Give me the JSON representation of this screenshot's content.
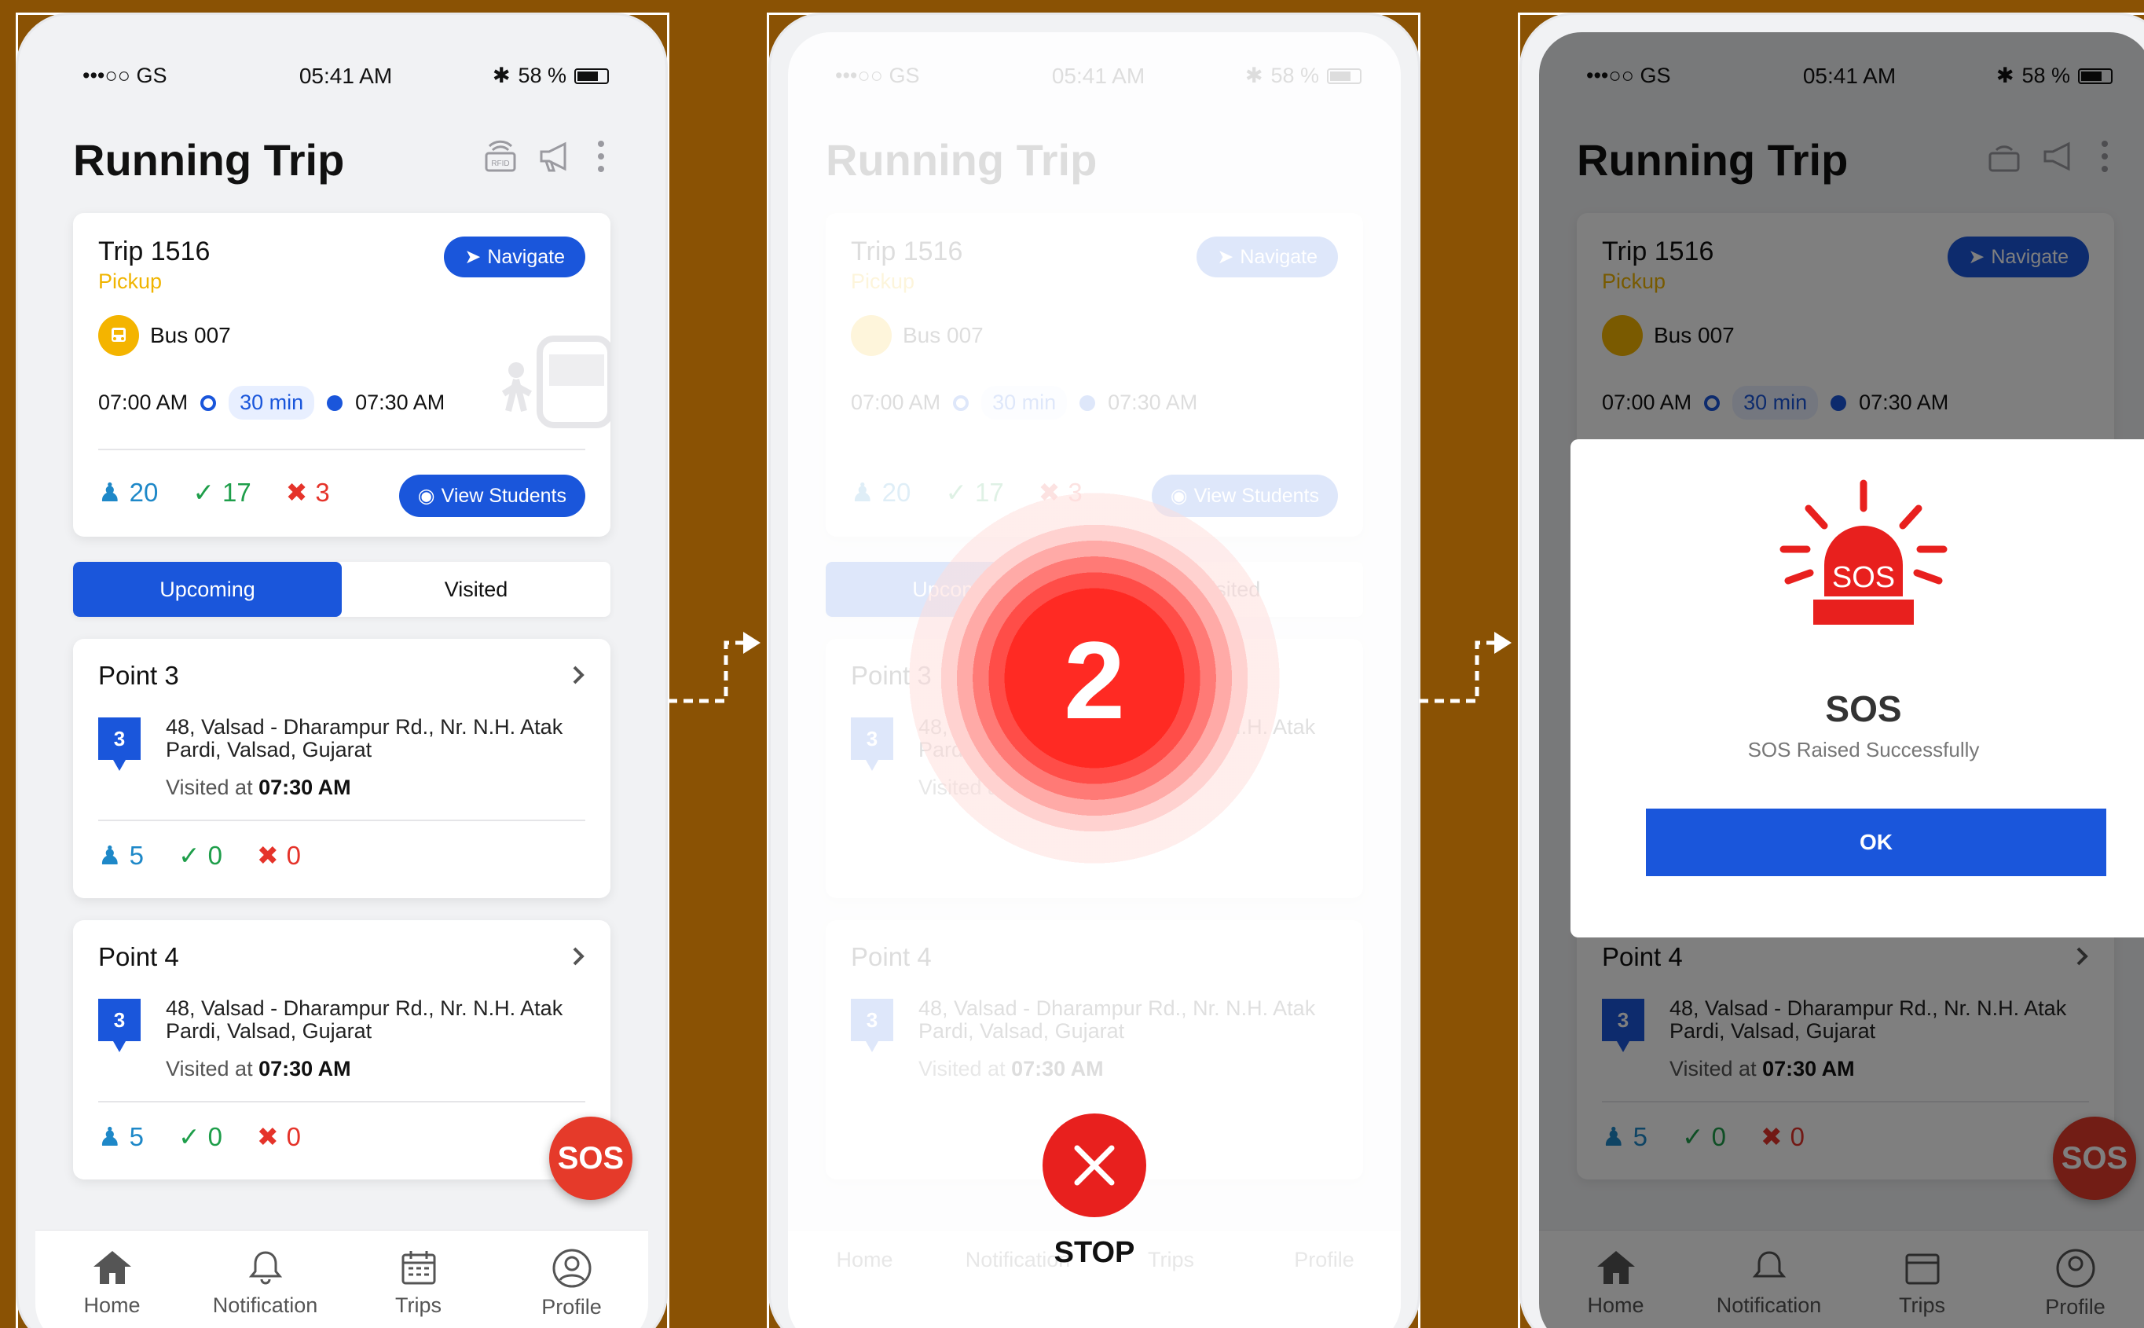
{
  "status": {
    "carrier": "•••○○ GS",
    "time": "05:41 AM",
    "battery": "58 %"
  },
  "header": {
    "title": "Running Trip"
  },
  "trip": {
    "name": "Trip 1516",
    "type": "Pickup",
    "navigate_label": "Navigate",
    "bus": "Bus 007",
    "start_time": "07:00 AM",
    "duration": "30 min",
    "end_time": "07:30 AM",
    "total": "20",
    "present": "17",
    "absent": "3",
    "view_students_label": "View Students"
  },
  "tabs": {
    "upcoming": "Upcoming",
    "visited": "Visited"
  },
  "points": [
    {
      "title": "Point 3",
      "pin": "3",
      "address": "48, Valsad - Dharampur Rd., Nr. N.H. Atak Pardi, Valsad, Gujarat",
      "visited_prefix": "Visited at",
      "visited_time": "07:30 AM",
      "total": "5",
      "present": "0",
      "absent": "0"
    },
    {
      "title": "Point 4",
      "pin": "3",
      "address": "48, Valsad - Dharampur Rd., Nr. N.H. Atak Pardi, Valsad, Gujarat",
      "visited_prefix": "Visited at",
      "visited_time": "07:30 AM",
      "total": "5",
      "present": "0",
      "absent": "0"
    }
  ],
  "sos_fab": "SOS",
  "tabbar": {
    "home": "Home",
    "notification": "Notification",
    "trips": "Trips",
    "profile": "Profile"
  },
  "countdown": {
    "value": "2",
    "stop_label": "STOP"
  },
  "sos_dialog": {
    "badge": "SOS",
    "title": "SOS",
    "subtitle": "SOS Raised Successfully",
    "ok_label": "OK"
  },
  "colors": {
    "background": "#8a5204",
    "primary": "#1a56db",
    "sos_red": "#e53a2a",
    "pickup_yellow": "#f0b400"
  }
}
